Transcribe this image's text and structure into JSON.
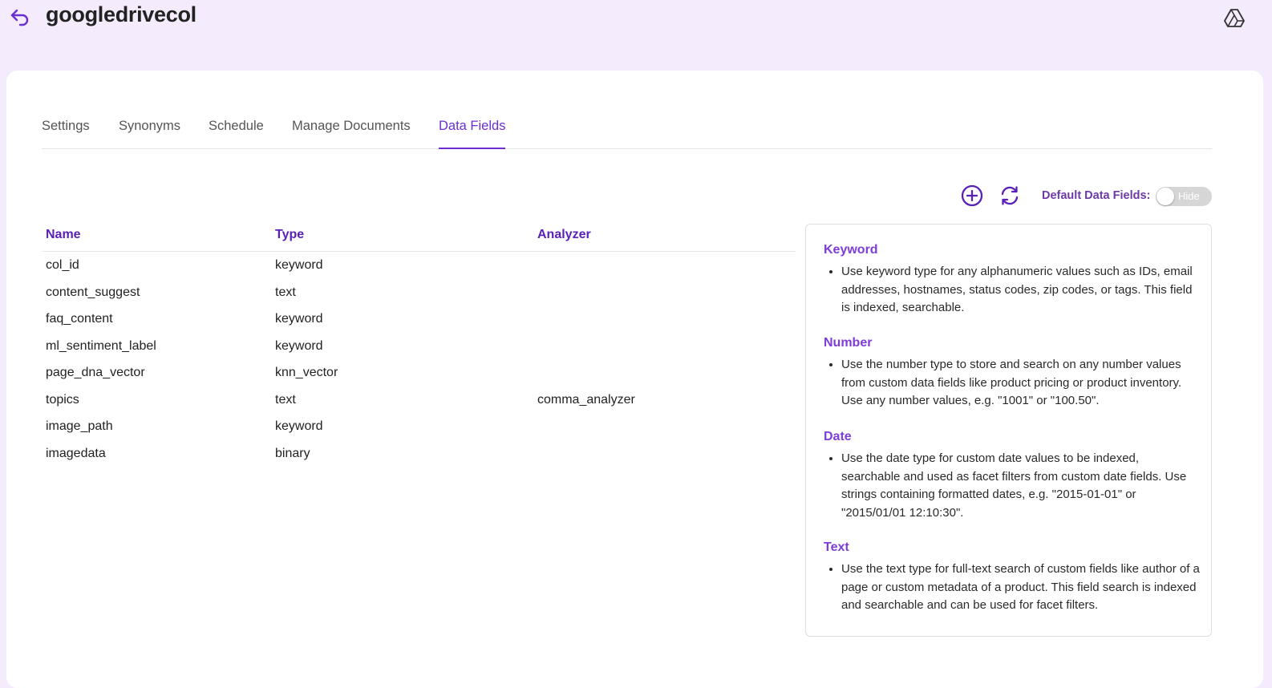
{
  "header": {
    "title": "googledrivecol",
    "back_icon": "undo-arrow-icon",
    "drive_icon": "google-drive-icon"
  },
  "tabs": [
    {
      "label": "Settings",
      "active": false
    },
    {
      "label": "Synonyms",
      "active": false
    },
    {
      "label": "Schedule",
      "active": false
    },
    {
      "label": "Manage Documents",
      "active": false
    },
    {
      "label": "Data Fields",
      "active": true
    }
  ],
  "toolbar": {
    "add_icon": "plus-circle-icon",
    "refresh_icon": "refresh-icon",
    "default_fields_label": "Default Data Fields:",
    "toggle_text": "Hide",
    "toggle_on": false
  },
  "table": {
    "columns": [
      "Name",
      "Type",
      "Analyzer"
    ],
    "rows": [
      {
        "name": "col_id",
        "type": "keyword",
        "analyzer": ""
      },
      {
        "name": "content_suggest",
        "type": "text",
        "analyzer": ""
      },
      {
        "name": "faq_content",
        "type": "keyword",
        "analyzer": ""
      },
      {
        "name": "ml_sentiment_label",
        "type": "keyword",
        "analyzer": ""
      },
      {
        "name": "page_dna_vector",
        "type": "knn_vector",
        "analyzer": ""
      },
      {
        "name": "topics",
        "type": "text",
        "analyzer": "comma_analyzer"
      },
      {
        "name": "image_path",
        "type": "keyword",
        "analyzer": ""
      },
      {
        "name": "imagedata",
        "type": "binary",
        "analyzer": ""
      }
    ]
  },
  "info": [
    {
      "heading": "Keyword",
      "text": "Use keyword type for any alphanumeric values such as IDs, email addresses, hostnames, status codes, zip codes, or tags. This field is indexed, searchable."
    },
    {
      "heading": "Number",
      "text": "Use the number type to store and search on any number values from custom data fields like product pricing or product inventory. Use any number values, e.g. \"1001\" or \"100.50\"."
    },
    {
      "heading": "Date",
      "text": "Use the date type for custom date values to be indexed, searchable and used as facet filters from custom date fields. Use strings containing formatted dates, e.g. \"2015-01-01\" or \"2015/01/01 12:10:30\"."
    },
    {
      "heading": "Text",
      "text": "Use the text type for full-text search of custom fields like author of a page or custom metadata of a product. This field search is indexed and searchable and can be used for facet filters."
    }
  ],
  "colors": {
    "accent": "#6b2fd0",
    "background": "#f4ecfd",
    "heading_purple": "#7e3cd8"
  }
}
